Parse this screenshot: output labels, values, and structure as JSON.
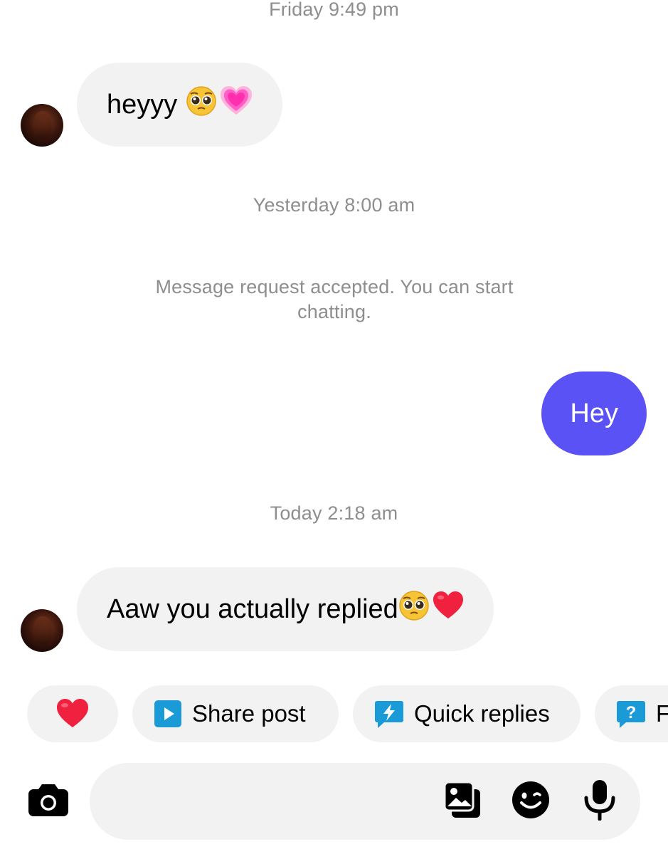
{
  "timestamps": {
    "friday": "Friday 9:49 pm",
    "yesterday": "Yesterday 8:00 am",
    "today": "Today 2:18 am"
  },
  "system_message": "Message request accepted. You can start chatting.",
  "messages": [
    {
      "direction": "incoming",
      "text": "heyyy",
      "emojis": [
        "pleading-face",
        "growing-heart"
      ]
    },
    {
      "direction": "outgoing",
      "text": "Hey"
    },
    {
      "direction": "incoming",
      "text": "Aaw you actually replied",
      "emojis": [
        "pleading-face",
        "red-heart"
      ]
    }
  ],
  "quick_actions": [
    {
      "label": "",
      "icon": "red-heart-icon"
    },
    {
      "label": "Share post",
      "icon": "play-square-icon"
    },
    {
      "label": "Quick replies",
      "icon": "lightning-bubble-icon"
    },
    {
      "label": "F",
      "icon": "question-bubble-icon"
    }
  ],
  "composer": {
    "placeholder": "",
    "icons": [
      "camera-icon",
      "gallery-icon",
      "sticker-icon",
      "microphone-icon"
    ]
  },
  "colors": {
    "outgoing_bubble": "#5a52f5",
    "incoming_bubble": "#f2f2f2",
    "timestamp_text": "#8e8e8e",
    "action_icon": "#1a9bd7"
  }
}
